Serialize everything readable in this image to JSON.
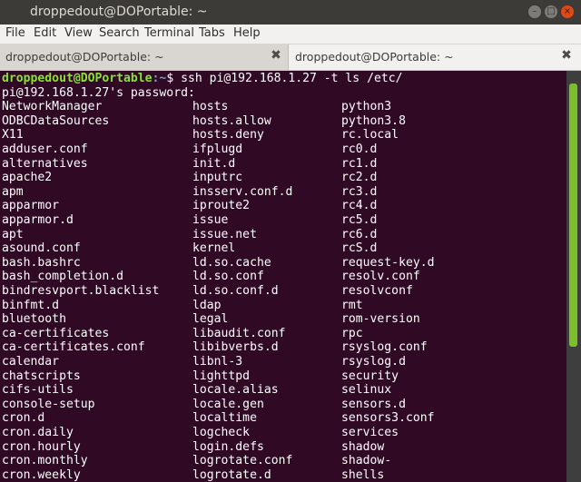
{
  "window": {
    "title": "droppedout@DOPortable: ~"
  },
  "menu": [
    "File",
    "Edit",
    "View",
    "Search",
    "Terminal",
    "Tabs",
    "Help"
  ],
  "tabs": [
    {
      "label": "droppedout@DOPortable: ~",
      "close": "✖"
    },
    {
      "label": "droppedout@DOPortable: ~",
      "close": "✖"
    }
  ],
  "terminal": {
    "prompt_user": "droppedout@DOPortable",
    "prompt_path": ":~",
    "prompt_symbol": "$ ",
    "command": "ssh pi@192.168.1.27 -t ls /etc/",
    "password_prompt": "pi@192.168.1.27's password:",
    "rows": [
      [
        "NetworkManager",
        "hosts",
        "python3"
      ],
      [
        "ODBCDataSources",
        "hosts.allow",
        "python3.8"
      ],
      [
        "X11",
        "hosts.deny",
        "rc.local"
      ],
      [
        "adduser.conf",
        "ifplugd",
        "rc0.d"
      ],
      [
        "alternatives",
        "init.d",
        "rc1.d"
      ],
      [
        "apache2",
        "inputrc",
        "rc2.d"
      ],
      [
        "apm",
        "insserv.conf.d",
        "rc3.d"
      ],
      [
        "apparmor",
        "iproute2",
        "rc4.d"
      ],
      [
        "apparmor.d",
        "issue",
        "rc5.d"
      ],
      [
        "apt",
        "issue.net",
        "rc6.d"
      ],
      [
        "asound.conf",
        "kernel",
        "rcS.d"
      ],
      [
        "bash.bashrc",
        "ld.so.cache",
        "request-key.d"
      ],
      [
        "bash_completion.d",
        "ld.so.conf",
        "resolv.conf"
      ],
      [
        "bindresvport.blacklist",
        "ld.so.conf.d",
        "resolvconf"
      ],
      [
        "binfmt.d",
        "ldap",
        "rmt"
      ],
      [
        "bluetooth",
        "legal",
        "rom-version"
      ],
      [
        "ca-certificates",
        "libaudit.conf",
        "rpc"
      ],
      [
        "ca-certificates.conf",
        "libibverbs.d",
        "rsyslog.conf"
      ],
      [
        "calendar",
        "libnl-3",
        "rsyslog.d"
      ],
      [
        "chatscripts",
        "lighttpd",
        "security"
      ],
      [
        "cifs-utils",
        "locale.alias",
        "selinux"
      ],
      [
        "console-setup",
        "locale.gen",
        "sensors.d"
      ],
      [
        "cron.d",
        "localtime",
        "sensors3.conf"
      ],
      [
        "cron.daily",
        "logcheck",
        "services"
      ],
      [
        "cron.hourly",
        "login.defs",
        "shadow"
      ],
      [
        "cron.monthly",
        "logrotate.conf",
        "shadow-"
      ],
      [
        "cron.weekly",
        "logrotate.d",
        "shells"
      ]
    ]
  },
  "colors": {
    "terminal_bg": "#300a24",
    "prompt_user": "#8ae234",
    "prompt_path": "#729fcf",
    "titlebar": "#3c3b37",
    "scroll_thumb": "#7cbf2a"
  }
}
